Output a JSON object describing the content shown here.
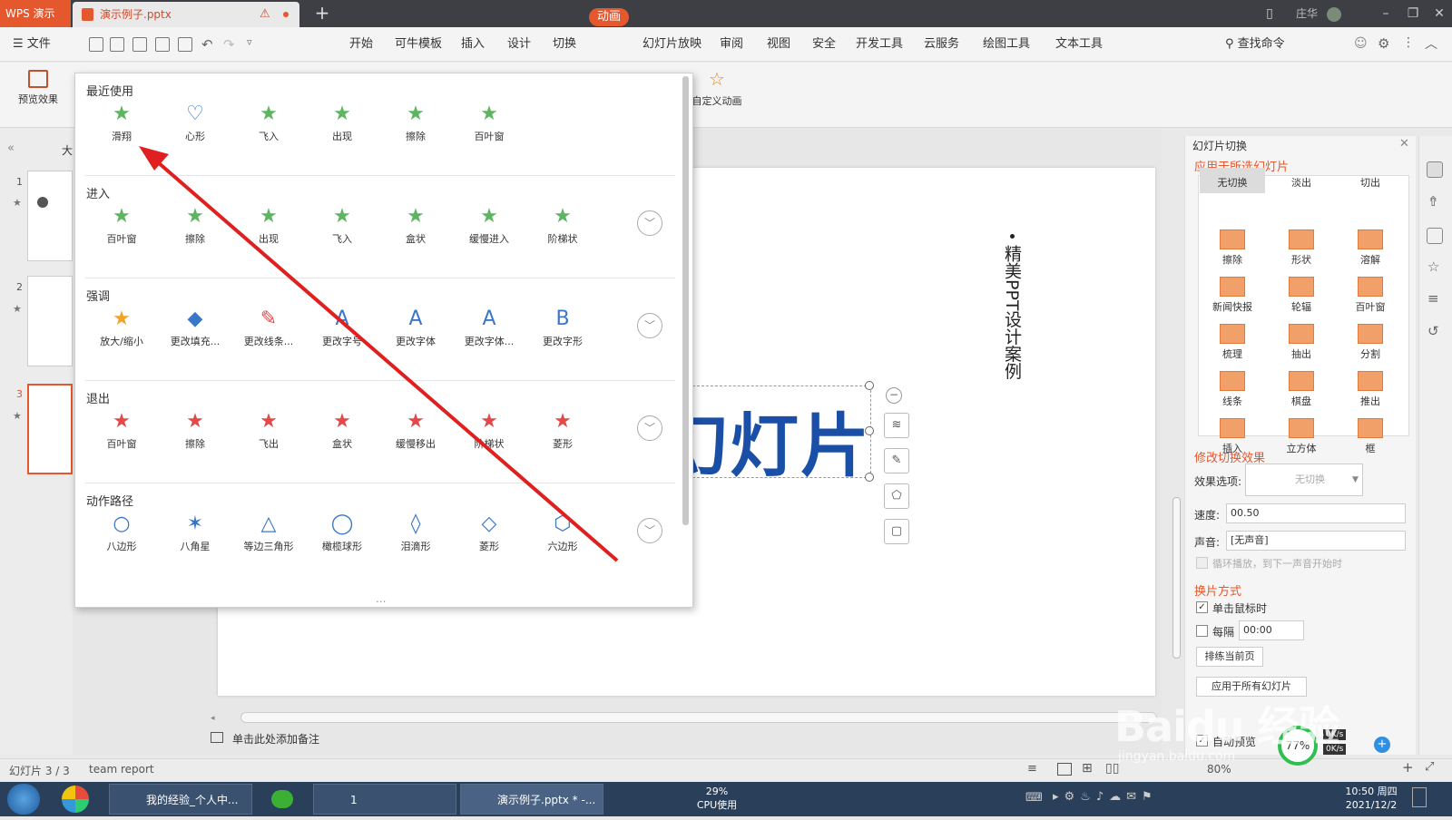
{
  "titlebar": {
    "app_tab": "WPS 演示",
    "doc_tab": "演示例子.pptx",
    "new_tab": "+",
    "user": "庄华",
    "warn_icon": "⚠"
  },
  "menubar": {
    "file": "☰ 文件",
    "items": [
      "开始",
      "可牛模板",
      "插入",
      "设计",
      "切换",
      "动画",
      "幻灯片放映",
      "审阅",
      "视图",
      "安全",
      "开发工具",
      "云服务",
      "绘图工具",
      "文本工具"
    ],
    "active": "动画",
    "search": "查找命令"
  },
  "ribbon": {
    "preview": "预览效果",
    "custom": "自定义动画"
  },
  "popup": {
    "recent": {
      "title": "最近使用",
      "items": [
        {
          "label": "滑翔",
          "glyph": "★",
          "color": "green"
        },
        {
          "label": "心形",
          "glyph": "♡",
          "color": "blue"
        },
        {
          "label": "飞入",
          "glyph": "★",
          "color": "green"
        },
        {
          "label": "出现",
          "glyph": "★",
          "color": "green"
        },
        {
          "label": "擦除",
          "glyph": "★",
          "color": "green"
        },
        {
          "label": "百叶窗",
          "glyph": "★",
          "color": "green"
        }
      ]
    },
    "enter": {
      "title": "进入",
      "items": [
        {
          "label": "百叶窗",
          "glyph": "★",
          "color": "green"
        },
        {
          "label": "擦除",
          "glyph": "★",
          "color": "green"
        },
        {
          "label": "出现",
          "glyph": "★",
          "color": "green"
        },
        {
          "label": "飞入",
          "glyph": "★",
          "color": "green"
        },
        {
          "label": "盒状",
          "glyph": "★",
          "color": "green"
        },
        {
          "label": "缓慢进入",
          "glyph": "★",
          "color": "green"
        },
        {
          "label": "阶梯状",
          "glyph": "★",
          "color": "green"
        }
      ]
    },
    "emphasis": {
      "title": "强调",
      "items": [
        {
          "label": "放大/缩小",
          "glyph": "★",
          "color": "orange"
        },
        {
          "label": "更改填充...",
          "glyph": "◆",
          "color": "blue"
        },
        {
          "label": "更改线条...",
          "glyph": "✎",
          "color": "red"
        },
        {
          "label": "更改字号",
          "glyph": "A",
          "color": "blue"
        },
        {
          "label": "更改字体",
          "glyph": "A",
          "color": "blue"
        },
        {
          "label": "更改字体...",
          "glyph": "A",
          "color": "blue"
        },
        {
          "label": "更改字形",
          "glyph": "B",
          "color": "blue"
        }
      ]
    },
    "exit": {
      "title": "退出",
      "items": [
        {
          "label": "百叶窗",
          "glyph": "★",
          "color": "red"
        },
        {
          "label": "擦除",
          "glyph": "★",
          "color": "red"
        },
        {
          "label": "飞出",
          "glyph": "★",
          "color": "red"
        },
        {
          "label": "盒状",
          "glyph": "★",
          "color": "red"
        },
        {
          "label": "缓慢移出",
          "glyph": "★",
          "color": "red"
        },
        {
          "label": "阶梯状",
          "glyph": "★",
          "color": "red"
        },
        {
          "label": "菱形",
          "glyph": "★",
          "color": "red"
        }
      ]
    },
    "path": {
      "title": "动作路径",
      "items": [
        {
          "label": "八边形",
          "glyph": "○",
          "color": "blue"
        },
        {
          "label": "八角星",
          "glyph": "✶",
          "color": "blue"
        },
        {
          "label": "等边三角形",
          "glyph": "△",
          "color": "blue"
        },
        {
          "label": "橄榄球形",
          "glyph": "◯",
          "color": "blue"
        },
        {
          "label": "泪滴形",
          "glyph": "◊",
          "color": "blue"
        },
        {
          "label": "菱形",
          "glyph": "◇",
          "color": "blue"
        },
        {
          "label": "六边形",
          "glyph": "⬡",
          "color": "blue"
        }
      ]
    },
    "more": "..."
  },
  "slide": {
    "title_text": "幻灯片",
    "vertical_text": "精美PPT设计案例"
  },
  "left_panel": {
    "collapse": "«",
    "tab": "大",
    "slides": [
      "1",
      "2",
      "3"
    ]
  },
  "notes": "单击此处添加备注",
  "right_panel": {
    "title": "幻灯片切换",
    "apply_selected": "应用于所选幻灯片",
    "transitions": [
      "无切换",
      "淡出",
      "切出",
      "擦除",
      "形状",
      "溶解",
      "新闻快报",
      "轮辐",
      "百叶窗",
      "梳理",
      "抽出",
      "分割",
      "线条",
      "棋盘",
      "推出",
      "插入",
      "立方体",
      "框"
    ],
    "modify": "修改切换效果",
    "effect_label": "效果选项:",
    "effect_value": "无切换",
    "speed_label": "速度:",
    "speed_value": "00.50",
    "sound_label": "声音:",
    "sound_value": "[无声音]",
    "loop_label": "循环播放，到下一声音开始时",
    "advance_title": "换片方式",
    "on_click": "单击鼠标时",
    "every": "每隔",
    "every_value": "00:00",
    "rehearse": "排练当前页",
    "apply_all": "应用于所有幻灯片",
    "autopreview": "自动预览"
  },
  "statusbar": {
    "slide_count": "幻灯片 3 / 3",
    "theme": "team report",
    "zoom": "80%"
  },
  "taskbar": {
    "items": [
      "我的经验_个人中...",
      "",
      "1",
      "演示例子.pptx * -..."
    ],
    "cpu_pct": "29%",
    "cpu_label": "CPU使用",
    "time": "10:50 周四",
    "date": "2021/12/2",
    "net_pct": "77%",
    "net_up": "0K/s",
    "net_down": "0K/s"
  },
  "watermark": {
    "brand": "Baidu 经验",
    "url": "jingyan.baidu.com"
  },
  "colors": {
    "accent": "#e5572c",
    "green_star": "#5db561",
    "red_star": "#e24a4a",
    "blue": "#3b77c9",
    "slide_title": "#1a4fa8",
    "annotation_arrow": "#e02020"
  }
}
